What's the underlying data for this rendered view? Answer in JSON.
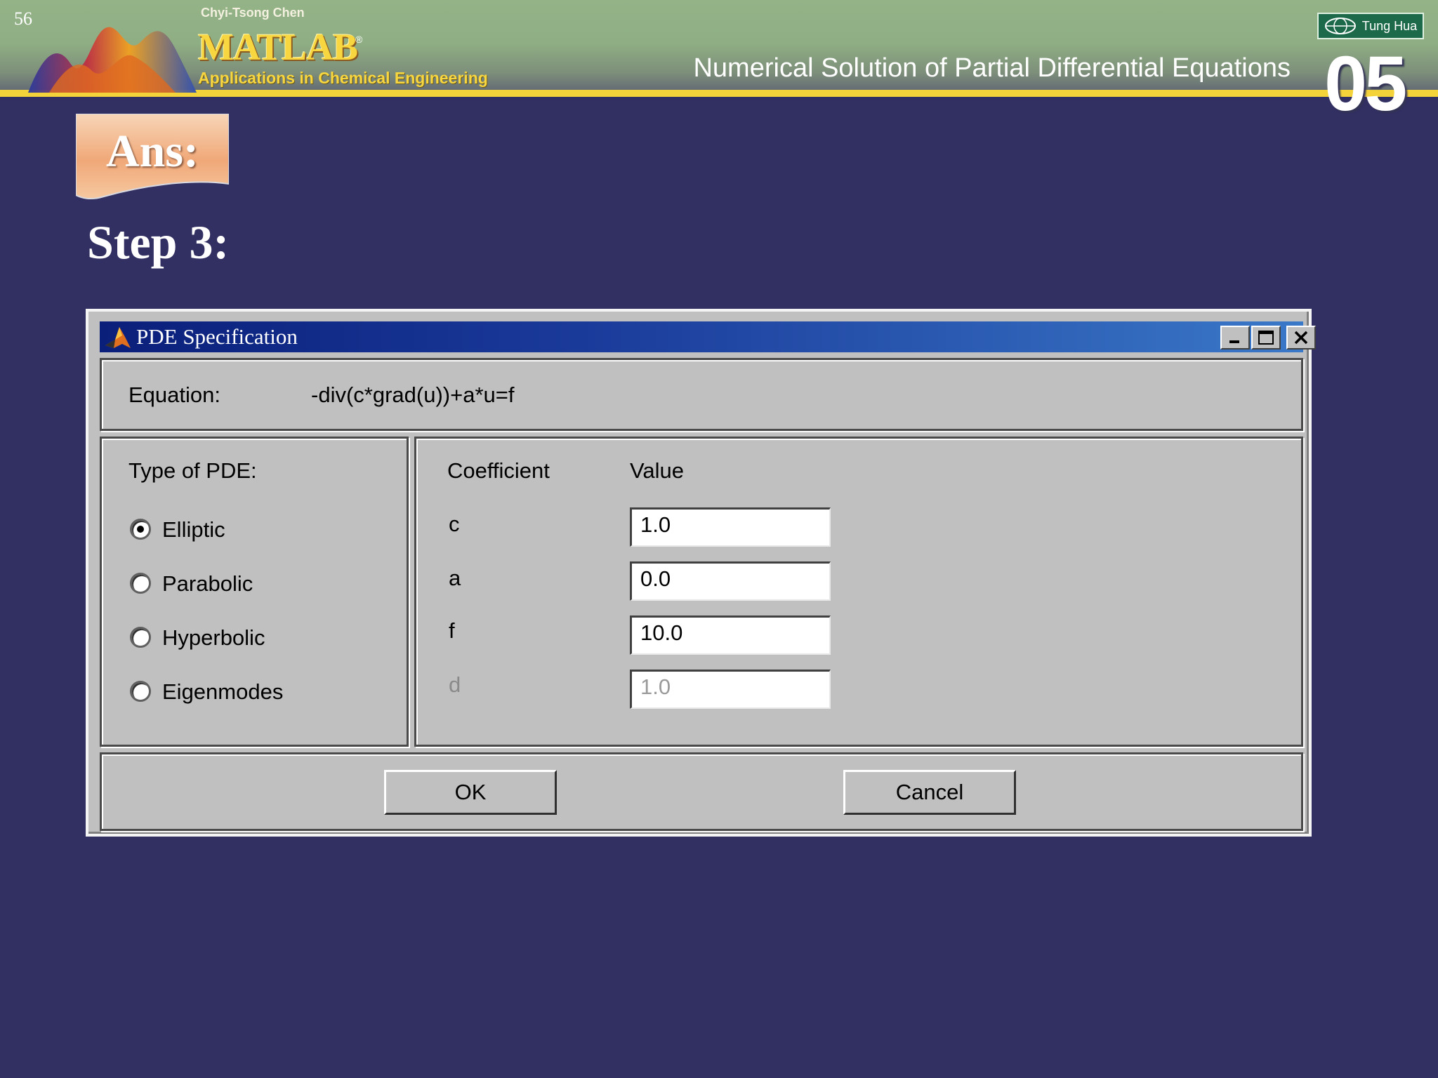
{
  "slide": {
    "page_number": "56",
    "author": "Chyi-Tsong Chen",
    "book_logo": "MATLAB",
    "reg_mark": "®",
    "book_subtitle": "Applications in Chemical Engineering",
    "chapter_title": "Numerical Solution of Partial Differential Equations",
    "publisher": "Tung Hua",
    "chapter_number": "05",
    "ans_label": "Ans:",
    "step_title": "Step 3:"
  },
  "dialog": {
    "title": "PDE Specification",
    "icon": "matlab-logo-icon",
    "equation_label": "Equation:",
    "equation_value": "-div(c*grad(u))+a*u=f",
    "type_label": "Type of PDE:",
    "pde_types": [
      {
        "label": "Elliptic",
        "selected": true
      },
      {
        "label": "Parabolic",
        "selected": false
      },
      {
        "label": "Hyperbolic",
        "selected": false
      },
      {
        "label": "Eigenmodes",
        "selected": false
      }
    ],
    "coefficient_header": "Coefficient",
    "value_header": "Value",
    "coefficients": [
      {
        "name": "c",
        "value": "1.0",
        "enabled": true
      },
      {
        "name": "a",
        "value": "0.0",
        "enabled": true
      },
      {
        "name": "f",
        "value": "10.0",
        "enabled": true
      },
      {
        "name": "d",
        "value": "1.0",
        "enabled": false
      }
    ],
    "ok_label": "OK",
    "cancel_label": "Cancel"
  },
  "colors": {
    "slide_background": "#322f63",
    "header_green": "#94b387",
    "header_rule": "#f3d23a",
    "titlebar_dark": "#0a1f7a",
    "titlebar_light": "#3a78c8",
    "dialog_face": "#c0c0c0"
  }
}
